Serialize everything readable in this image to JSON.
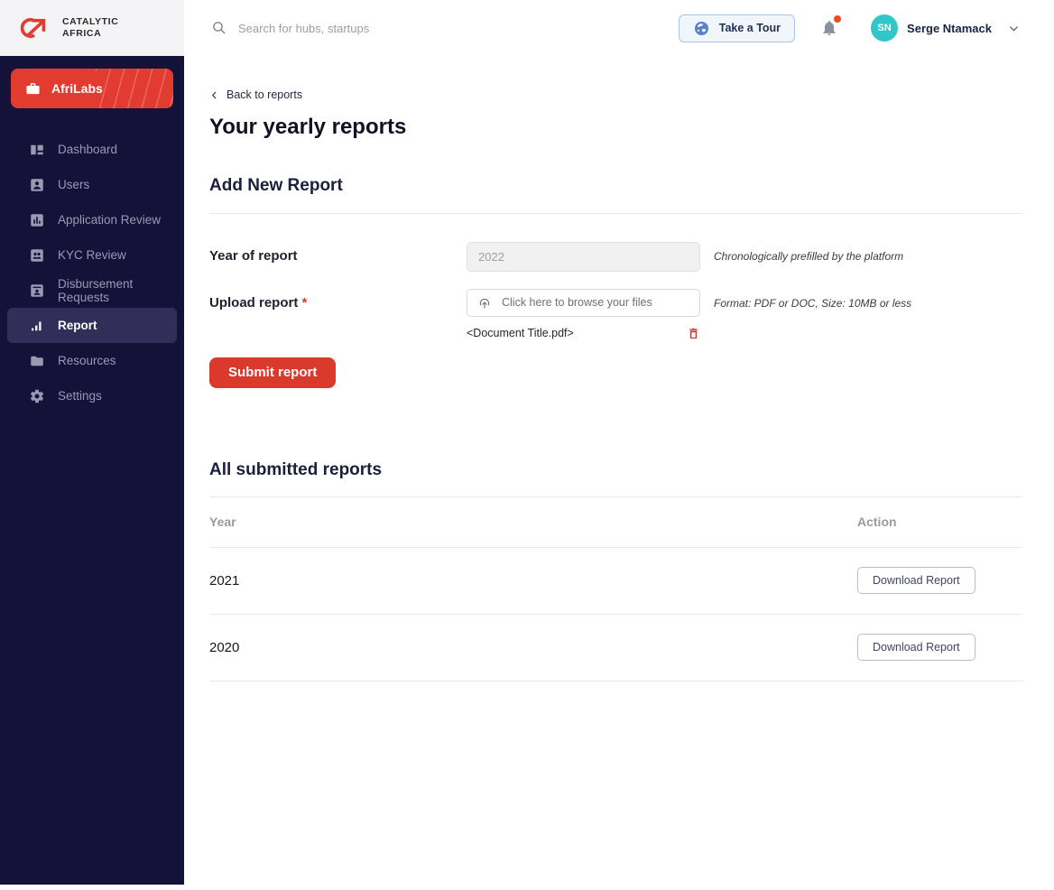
{
  "brand": {
    "line1": "CATALYTIC",
    "line2": "AFRICA"
  },
  "topbar": {
    "search_placeholder": "Search for hubs, startups",
    "tour_label": "Take a Tour",
    "user": {
      "initials": "SN",
      "name": "Serge Ntamack"
    }
  },
  "sidebar": {
    "org_label": "AfriLabs",
    "items": [
      {
        "label": "Dashboard",
        "icon": "dashboard-icon",
        "active": false
      },
      {
        "label": "Users",
        "icon": "users-icon",
        "active": false
      },
      {
        "label": "Application Review",
        "icon": "application-review-icon",
        "active": false
      },
      {
        "label": "KYC Review",
        "icon": "kyc-review-icon",
        "active": false
      },
      {
        "label": "Disbursement Requests",
        "icon": "disbursement-icon",
        "active": false
      },
      {
        "label": "Report",
        "icon": "report-icon",
        "active": true
      },
      {
        "label": "Resources",
        "icon": "folder-icon",
        "active": false
      },
      {
        "label": "Settings",
        "icon": "gear-icon",
        "active": false
      }
    ]
  },
  "page": {
    "back_link": "Back to reports",
    "title": "Your yearly reports"
  },
  "form": {
    "heading": "Add New Report",
    "year_label": "Year of report",
    "year_value": "2022",
    "year_hint": "Chronologically prefilled by the platform",
    "upload_label": "Upload report ",
    "required_mark": "*",
    "upload_placeholder": "Click here to browse your files",
    "upload_hint": "Format: PDF or DOC, Size: 10MB or less",
    "uploaded_file": "<Document Title.pdf>",
    "submit_label": "Submit report"
  },
  "reports": {
    "heading": "All submitted reports",
    "columns": {
      "year": "Year",
      "action": "Action"
    },
    "rows": [
      {
        "year": "2021",
        "action": "Download Report"
      },
      {
        "year": "2020",
        "action": "Download Report"
      }
    ]
  },
  "colors": {
    "sidebar_bg": "#141239",
    "accent_red": "#d93a2c",
    "avatar_teal": "#31c6c8",
    "notification_dot": "#f4491d"
  }
}
